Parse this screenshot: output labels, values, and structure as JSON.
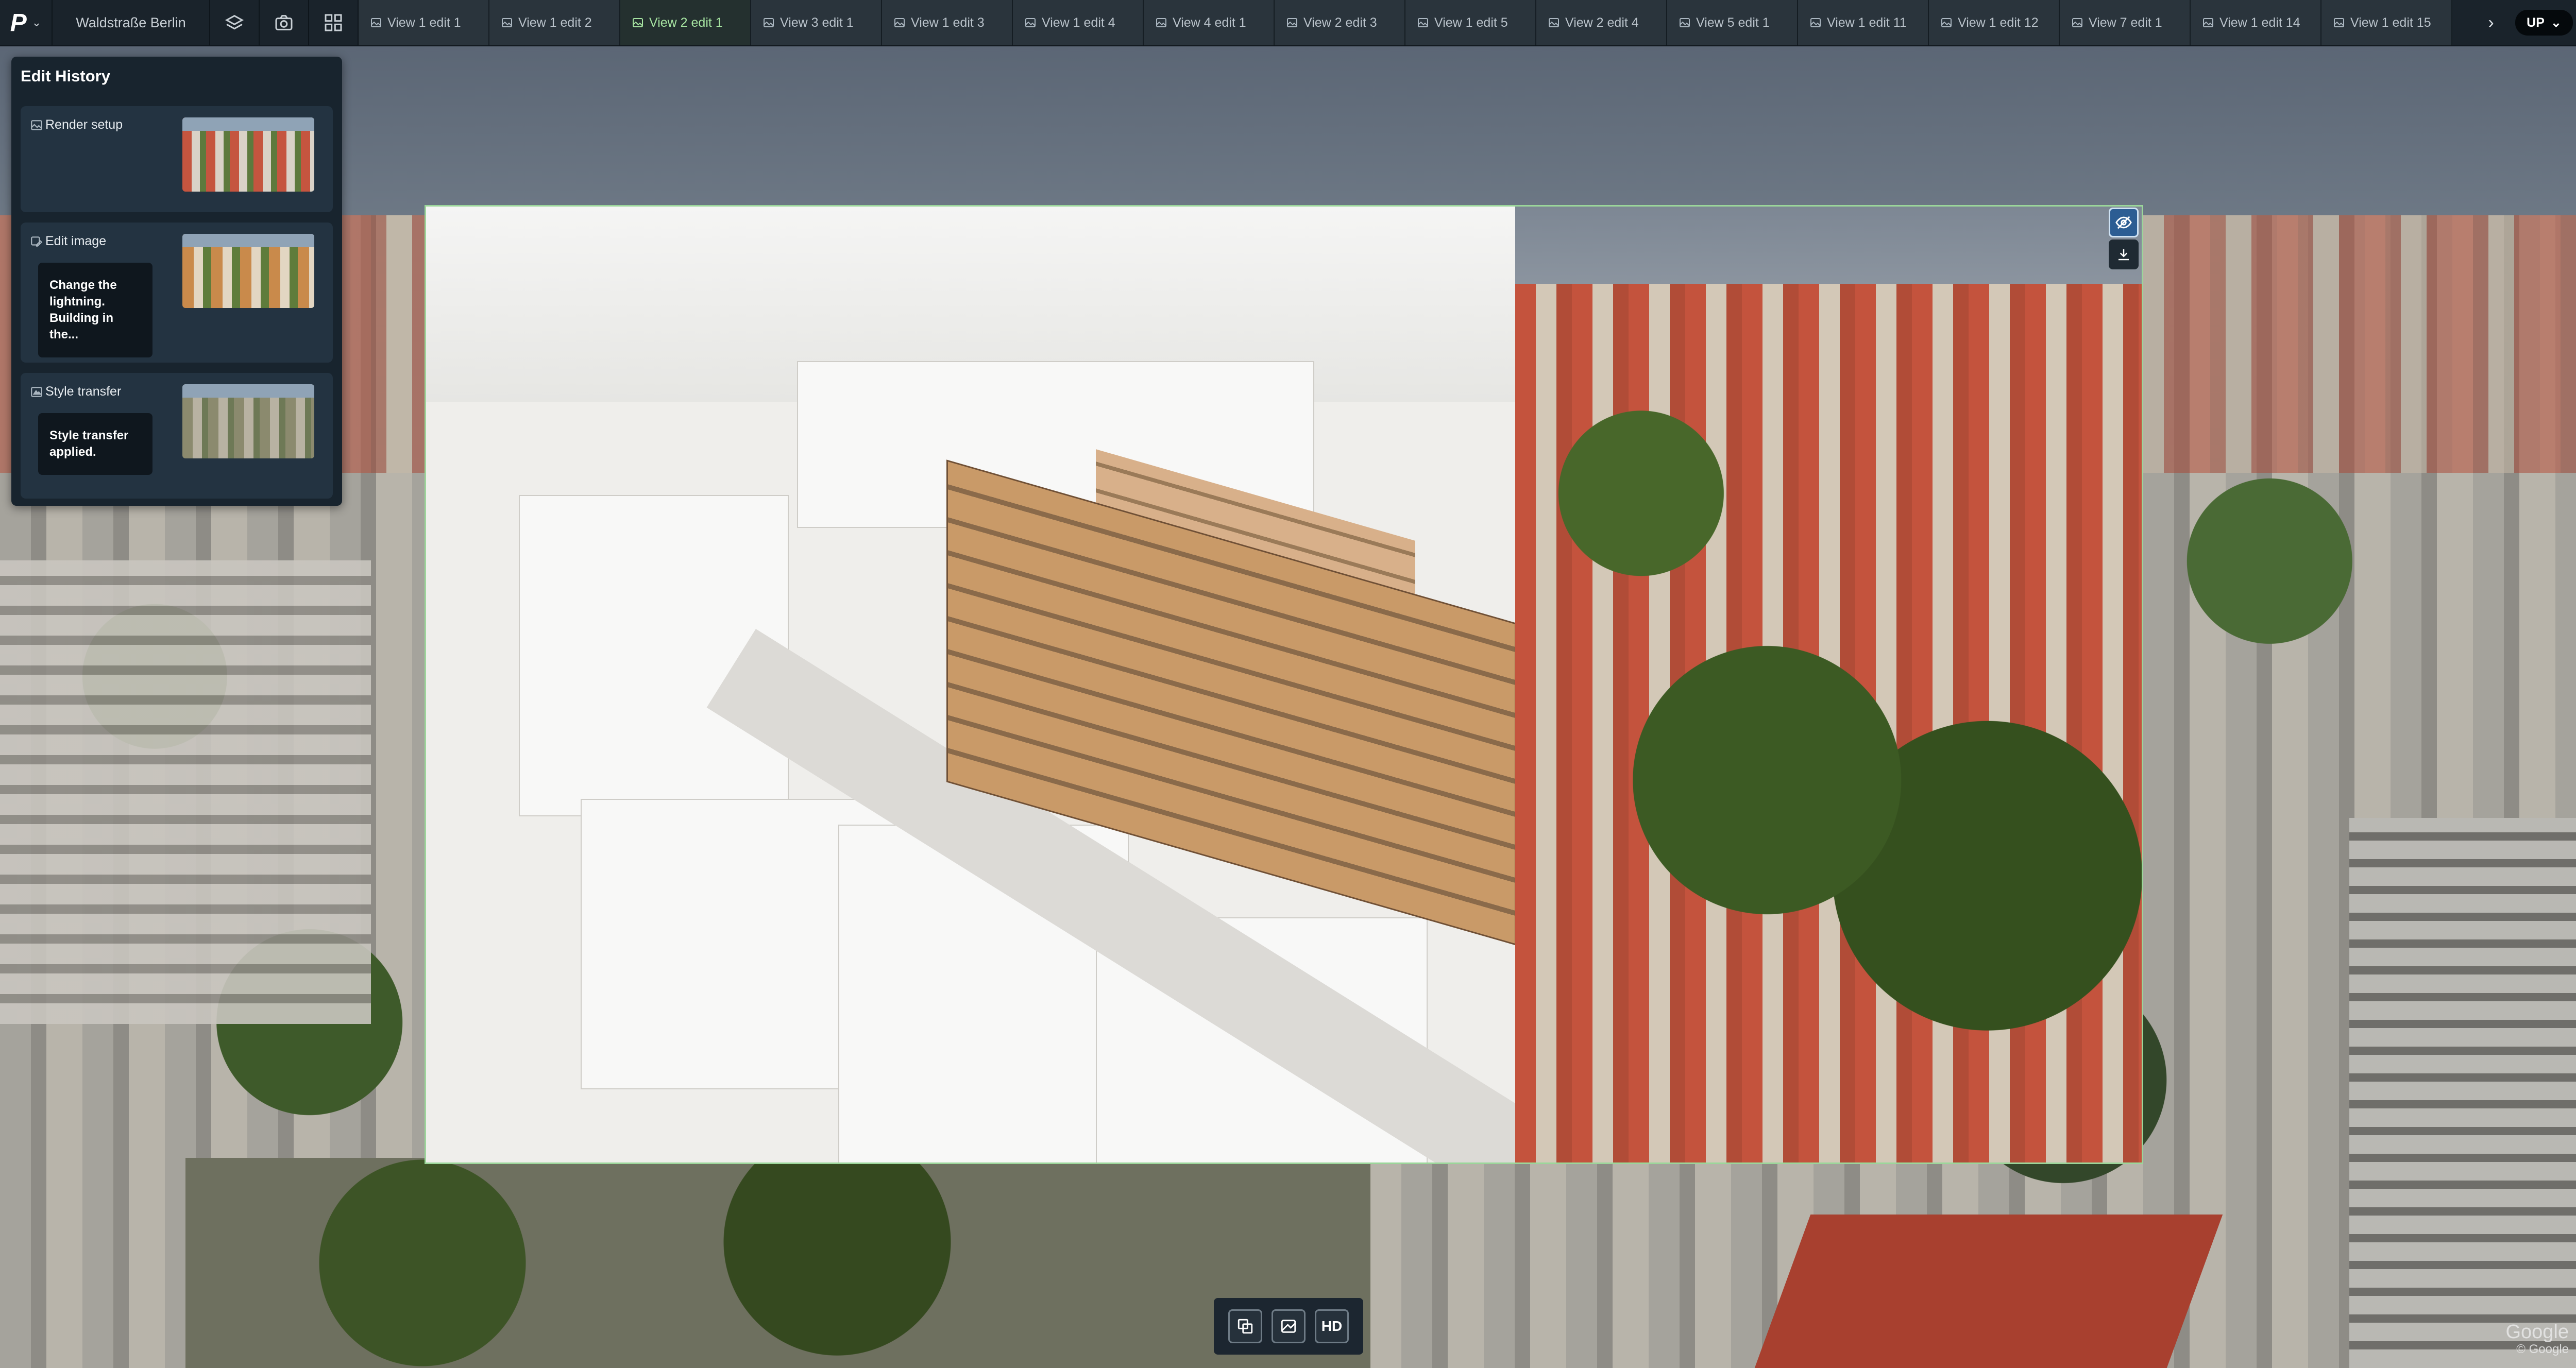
{
  "topbar": {
    "logo_icon": "p-logo-icon",
    "project_name": "Waldstraße Berlin",
    "tool_icons": [
      "layers-icon",
      "camera-icon",
      "grid-icon"
    ],
    "tabs": [
      {
        "label": "View 1 edit 1",
        "active": false
      },
      {
        "label": "View 1 edit 2",
        "active": false
      },
      {
        "label": "View 2 edit 1",
        "active": true
      },
      {
        "label": "View 3 edit 1",
        "active": false
      },
      {
        "label": "View 1 edit 3",
        "active": false
      },
      {
        "label": "View 1 edit 4",
        "active": false
      },
      {
        "label": "View 4 edit 1",
        "active": false
      },
      {
        "label": "View 2 edit 3",
        "active": false
      },
      {
        "label": "View 1 edit 5",
        "active": false
      },
      {
        "label": "View 2 edit 4",
        "active": false
      },
      {
        "label": "View 5 edit 1",
        "active": false
      },
      {
        "label": "View 1 edit 11",
        "active": false
      },
      {
        "label": "View 1 edit 12",
        "active": false
      },
      {
        "label": "View 7 edit 1",
        "active": false
      },
      {
        "label": "View 1 edit 14",
        "active": false
      },
      {
        "label": "View 1 edit 15",
        "active": false
      }
    ],
    "more_icon": "chevron-right-icon",
    "user_initials": "UP"
  },
  "history": {
    "title": "Edit History",
    "items": [
      {
        "label": "Render setup",
        "icon": "image-icon",
        "note": ""
      },
      {
        "label": "Edit image",
        "icon": "edit-image-icon",
        "note": "Change the lightning. Building in the..."
      },
      {
        "label": "Style transfer",
        "icon": "style-icon",
        "note": "Style transfer applied."
      }
    ]
  },
  "viewport": {
    "toggle_icon": "eye-off-icon",
    "download_icon": "download-icon"
  },
  "bottombar": {
    "hd_label": "HD"
  },
  "attribution": {
    "brand": "Google",
    "copyright": "© Google"
  },
  "colors": {
    "accent_green": "#a6e3a1",
    "viewport_border": "#9bd69a",
    "active_button": "#2c5d93"
  }
}
